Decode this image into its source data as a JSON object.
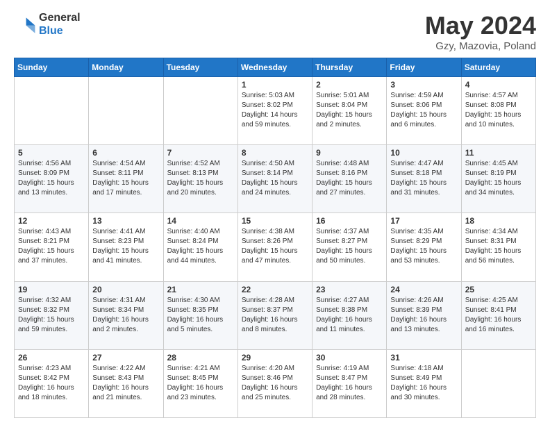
{
  "logo": {
    "line1": "General",
    "line2": "Blue"
  },
  "title": "May 2024",
  "subtitle": "Gzy, Mazovia, Poland",
  "days_of_week": [
    "Sunday",
    "Monday",
    "Tuesday",
    "Wednesday",
    "Thursday",
    "Friday",
    "Saturday"
  ],
  "weeks": [
    [
      {
        "day": "",
        "info": ""
      },
      {
        "day": "",
        "info": ""
      },
      {
        "day": "",
        "info": ""
      },
      {
        "day": "1",
        "info": "Sunrise: 5:03 AM\nSunset: 8:02 PM\nDaylight: 14 hours\nand 59 minutes."
      },
      {
        "day": "2",
        "info": "Sunrise: 5:01 AM\nSunset: 8:04 PM\nDaylight: 15 hours\nand 2 minutes."
      },
      {
        "day": "3",
        "info": "Sunrise: 4:59 AM\nSunset: 8:06 PM\nDaylight: 15 hours\nand 6 minutes."
      },
      {
        "day": "4",
        "info": "Sunrise: 4:57 AM\nSunset: 8:08 PM\nDaylight: 15 hours\nand 10 minutes."
      }
    ],
    [
      {
        "day": "5",
        "info": "Sunrise: 4:56 AM\nSunset: 8:09 PM\nDaylight: 15 hours\nand 13 minutes."
      },
      {
        "day": "6",
        "info": "Sunrise: 4:54 AM\nSunset: 8:11 PM\nDaylight: 15 hours\nand 17 minutes."
      },
      {
        "day": "7",
        "info": "Sunrise: 4:52 AM\nSunset: 8:13 PM\nDaylight: 15 hours\nand 20 minutes."
      },
      {
        "day": "8",
        "info": "Sunrise: 4:50 AM\nSunset: 8:14 PM\nDaylight: 15 hours\nand 24 minutes."
      },
      {
        "day": "9",
        "info": "Sunrise: 4:48 AM\nSunset: 8:16 PM\nDaylight: 15 hours\nand 27 minutes."
      },
      {
        "day": "10",
        "info": "Sunrise: 4:47 AM\nSunset: 8:18 PM\nDaylight: 15 hours\nand 31 minutes."
      },
      {
        "day": "11",
        "info": "Sunrise: 4:45 AM\nSunset: 8:19 PM\nDaylight: 15 hours\nand 34 minutes."
      }
    ],
    [
      {
        "day": "12",
        "info": "Sunrise: 4:43 AM\nSunset: 8:21 PM\nDaylight: 15 hours\nand 37 minutes."
      },
      {
        "day": "13",
        "info": "Sunrise: 4:41 AM\nSunset: 8:23 PM\nDaylight: 15 hours\nand 41 minutes."
      },
      {
        "day": "14",
        "info": "Sunrise: 4:40 AM\nSunset: 8:24 PM\nDaylight: 15 hours\nand 44 minutes."
      },
      {
        "day": "15",
        "info": "Sunrise: 4:38 AM\nSunset: 8:26 PM\nDaylight: 15 hours\nand 47 minutes."
      },
      {
        "day": "16",
        "info": "Sunrise: 4:37 AM\nSunset: 8:27 PM\nDaylight: 15 hours\nand 50 minutes."
      },
      {
        "day": "17",
        "info": "Sunrise: 4:35 AM\nSunset: 8:29 PM\nDaylight: 15 hours\nand 53 minutes."
      },
      {
        "day": "18",
        "info": "Sunrise: 4:34 AM\nSunset: 8:31 PM\nDaylight: 15 hours\nand 56 minutes."
      }
    ],
    [
      {
        "day": "19",
        "info": "Sunrise: 4:32 AM\nSunset: 8:32 PM\nDaylight: 15 hours\nand 59 minutes."
      },
      {
        "day": "20",
        "info": "Sunrise: 4:31 AM\nSunset: 8:34 PM\nDaylight: 16 hours\nand 2 minutes."
      },
      {
        "day": "21",
        "info": "Sunrise: 4:30 AM\nSunset: 8:35 PM\nDaylight: 16 hours\nand 5 minutes."
      },
      {
        "day": "22",
        "info": "Sunrise: 4:28 AM\nSunset: 8:37 PM\nDaylight: 16 hours\nand 8 minutes."
      },
      {
        "day": "23",
        "info": "Sunrise: 4:27 AM\nSunset: 8:38 PM\nDaylight: 16 hours\nand 11 minutes."
      },
      {
        "day": "24",
        "info": "Sunrise: 4:26 AM\nSunset: 8:39 PM\nDaylight: 16 hours\nand 13 minutes."
      },
      {
        "day": "25",
        "info": "Sunrise: 4:25 AM\nSunset: 8:41 PM\nDaylight: 16 hours\nand 16 minutes."
      }
    ],
    [
      {
        "day": "26",
        "info": "Sunrise: 4:23 AM\nSunset: 8:42 PM\nDaylight: 16 hours\nand 18 minutes."
      },
      {
        "day": "27",
        "info": "Sunrise: 4:22 AM\nSunset: 8:43 PM\nDaylight: 16 hours\nand 21 minutes."
      },
      {
        "day": "28",
        "info": "Sunrise: 4:21 AM\nSunset: 8:45 PM\nDaylight: 16 hours\nand 23 minutes."
      },
      {
        "day": "29",
        "info": "Sunrise: 4:20 AM\nSunset: 8:46 PM\nDaylight: 16 hours\nand 25 minutes."
      },
      {
        "day": "30",
        "info": "Sunrise: 4:19 AM\nSunset: 8:47 PM\nDaylight: 16 hours\nand 28 minutes."
      },
      {
        "day": "31",
        "info": "Sunrise: 4:18 AM\nSunset: 8:49 PM\nDaylight: 16 hours\nand 30 minutes."
      },
      {
        "day": "",
        "info": ""
      }
    ]
  ]
}
